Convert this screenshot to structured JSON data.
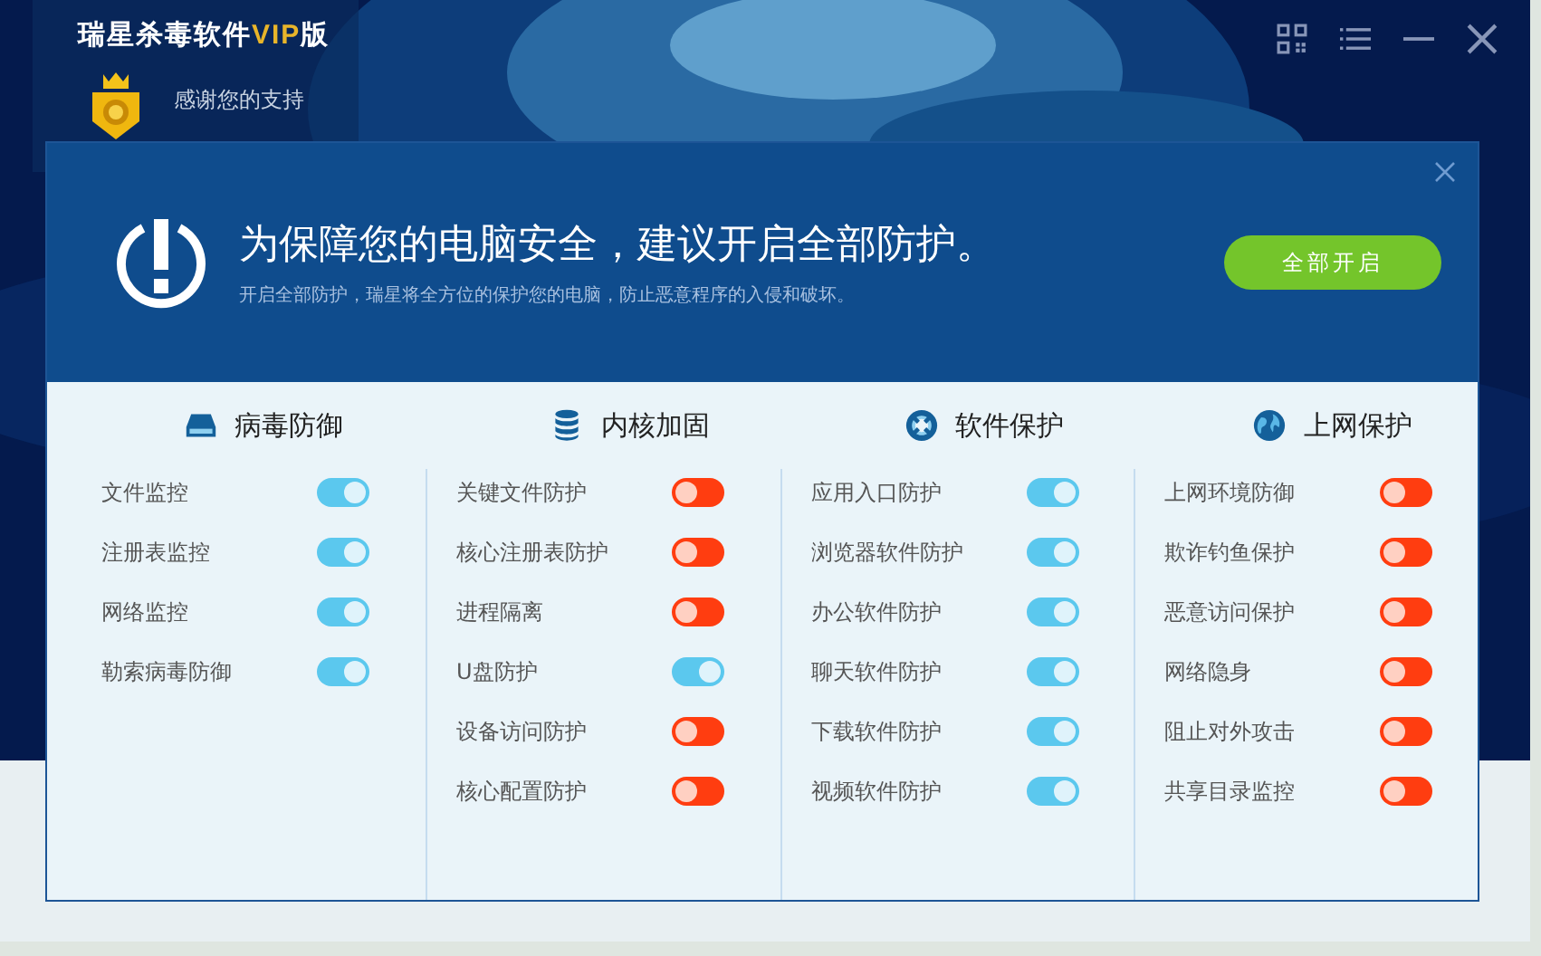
{
  "window": {
    "title": "瑞星杀毒软件",
    "edition": "VIP",
    "suffix": "版"
  },
  "account": {
    "message": "感谢您的支持"
  },
  "dialog": {
    "headline": "为保障您的电脑安全，建议开启全部防护。",
    "description": "开启全部防护，瑞星将全方位的保护您的电脑，防止恶意程序的入侵和破坏。",
    "button": "全部开启"
  },
  "sections": [
    {
      "title": "病毒防御",
      "kind": "drive",
      "items": [
        {
          "label": "文件监控",
          "on": true
        },
        {
          "label": "注册表监控",
          "on": true
        },
        {
          "label": "网络监控",
          "on": true
        },
        {
          "label": "勒索病毒防御",
          "on": true
        }
      ]
    },
    {
      "title": "内核加固",
      "kind": "database",
      "items": [
        {
          "label": "关键文件防护",
          "on": false
        },
        {
          "label": "核心注册表防护",
          "on": false
        },
        {
          "label": "进程隔离",
          "on": false
        },
        {
          "label": "U盘防护",
          "on": true
        },
        {
          "label": "设备访问防护",
          "on": false
        },
        {
          "label": "核心配置防护",
          "on": false
        }
      ]
    },
    {
      "title": "软件保护",
      "kind": "lifebuoy",
      "items": [
        {
          "label": "应用入口防护",
          "on": true
        },
        {
          "label": "浏览器软件防护",
          "on": true
        },
        {
          "label": "办公软件防护",
          "on": true
        },
        {
          "label": "聊天软件防护",
          "on": true
        },
        {
          "label": "下载软件防护",
          "on": true
        },
        {
          "label": "视频软件防护",
          "on": true
        }
      ]
    },
    {
      "title": "上网保护",
      "kind": "globe",
      "items": [
        {
          "label": "上网环境防御",
          "on": false
        },
        {
          "label": "欺诈钓鱼保护",
          "on": false
        },
        {
          "label": "恶意访问保护",
          "on": false
        },
        {
          "label": "网络隐身",
          "on": false
        },
        {
          "label": "阻止对外攻击",
          "on": false
        },
        {
          "label": "共享目录监控",
          "on": false
        }
      ]
    }
  ]
}
